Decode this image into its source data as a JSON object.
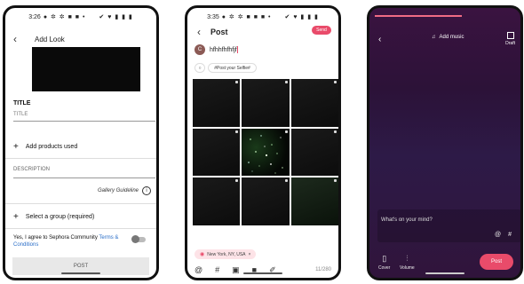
{
  "screen1": {
    "status_time": "3:26",
    "header_title": "Add Look",
    "title_label": "TITLE",
    "title_placeholder": "TITLE",
    "add_products": "Add products used",
    "description_placeholder": "DESCRIPTION",
    "gallery_guideline": "Gallery Guideline",
    "select_group": "Select a group (required)",
    "agree_prefix": "Yes, I agree to Sephora Community",
    "agree_link": "Terms & Conditions",
    "post_button": "POST"
  },
  "screen2": {
    "status_time": "3:35",
    "header_title": "Post",
    "send_button": "Send",
    "avatar_letter": "C",
    "caption_text": "hfhhfhfhfjf",
    "hashtag_pill": "#Post your Selfie#",
    "location": "New York, NY, USA",
    "char_count": "11/280"
  },
  "screen3": {
    "add_music": "Add music",
    "draft_label": "Draft",
    "mind_placeholder": "What's on your mind?",
    "cover_label": "Cover",
    "volume_label": "Volume",
    "post_button": "Post",
    "upload_progress": 0.6
  }
}
